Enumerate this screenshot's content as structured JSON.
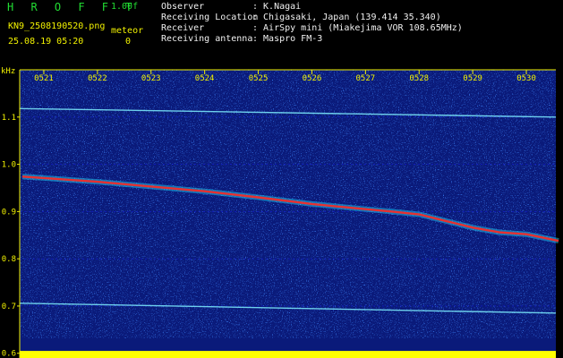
{
  "header": {
    "title": "H R O F F T",
    "version": "1.00f",
    "filename": "KN9_2508190520.png",
    "datetime": "25.08.19 05:20",
    "meteor_label": "meteor",
    "meteor_count": "0",
    "info": [
      {
        "label": "Observer",
        "value": ": K.Nagai"
      },
      {
        "label": "Receiving Location",
        "value": ": Chigasaki, Japan (139.414 35.340)"
      },
      {
        "label": "Receiver",
        "value": ": AirSpy mini (Miakejima VOR 108.65MHz)"
      },
      {
        "label": "Receiving antenna",
        "value": ": Maspro FM-3"
      }
    ]
  },
  "chart_data": {
    "type": "heatmap",
    "y_unit_label": "kHz",
    "x_tick_labels": [
      "0521",
      "0522",
      "0523",
      "0524",
      "0525",
      "0526",
      "0527",
      "0528",
      "0529",
      "0530"
    ],
    "y_tick_labels": [
      "1.1",
      "1.0",
      "0.9",
      "0.8",
      "0.7",
      "0.6"
    ],
    "y_ticks": [
      1.1,
      1.0,
      0.9,
      0.8,
      0.7,
      0.6
    ],
    "ylim": [
      0.59,
      1.2
    ],
    "x_minutes": [
      21,
      31
    ],
    "carrier_trace": {
      "x": [
        20.6,
        21,
        22,
        23,
        24,
        25,
        26,
        27,
        27.5,
        28,
        28.5,
        29,
        29.5,
        30,
        30.6
      ],
      "y": [
        0.974,
        0.971,
        0.963,
        0.953,
        0.943,
        0.93,
        0.916,
        0.905,
        0.9,
        0.894,
        0.88,
        0.866,
        0.856,
        0.852,
        0.838
      ]
    },
    "lines": [
      {
        "y_start": 1.118,
        "y_end": 1.1
      },
      {
        "y_start": 0.706,
        "y_end": 0.685
      }
    ],
    "colors": {
      "background": "#0a1a7a",
      "trace": "#e83030",
      "trace_halo": "#22e0ff",
      "line": "#7ff0ff",
      "noise_floor": "#ffff00",
      "axis": "#f2f200",
      "grid": "#1a1aff"
    }
  }
}
